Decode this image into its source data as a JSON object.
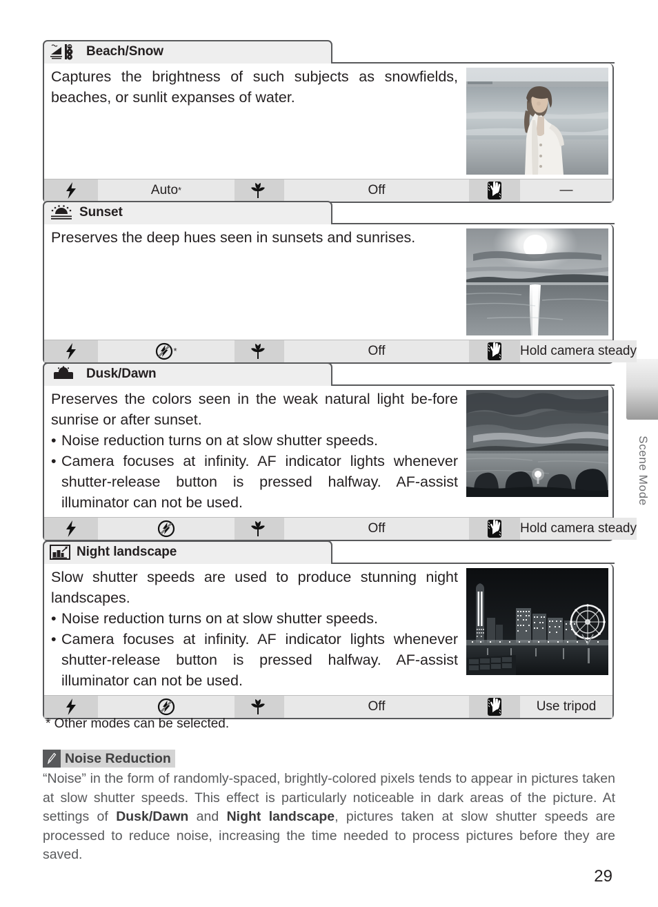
{
  "page": {
    "number": "29",
    "side_tab_label": "Scene Mode",
    "footnote": "* Other modes can be selected."
  },
  "scenes": [
    {
      "id": "beach-snow",
      "icon": "beach-snow-icon",
      "title": "Beach/Snow",
      "description": "Captures the brightness of such subjects as snowfields, beaches, or sunlit expanses of water.",
      "bullets": [],
      "photo": {
        "name": "beach-photo",
        "alt": "Woman in white vest standing on a bright beach"
      },
      "settings": {
        "flash_icon": "flash-icon",
        "flash_value": "Auto",
        "flash_star": true,
        "macro_icon": "macro-tulip-icon",
        "macro_value": "Off",
        "shake_icon": "camera-shake-icon",
        "shake_value": "—"
      }
    },
    {
      "id": "sunset",
      "icon": "sunset-icon",
      "title": "Sunset",
      "description": "Preserves the deep hues seen in sunsets and sunrises.",
      "bullets": [],
      "photo": {
        "name": "sunset-photo",
        "alt": "Sun setting over water with reflection"
      },
      "settings": {
        "flash_icon": "flash-icon",
        "flash_value": "",
        "flash_value_icon": "flash-off-icon",
        "flash_star": true,
        "macro_icon": "macro-tulip-icon",
        "macro_value": "Off",
        "shake_icon": "camera-shake-icon",
        "shake_value": "Hold camera steady"
      }
    },
    {
      "id": "dusk-dawn",
      "icon": "dusk-dawn-icon",
      "title": "Dusk/Dawn",
      "description": "Preserves the colors seen in the weak natural light be-fore sunrise or after sunset.",
      "bullets": [
        "Noise reduction turns on at slow shutter speeds.",
        "Camera focuses at infinity.  AF indicator lights whenever shutter-release button is pressed halfway.  AF-assist illuminator can not be used."
      ],
      "photo": {
        "name": "dusk-photo",
        "alt": "Dark clouds over a lake at dusk with trees in silhouette"
      },
      "settings": {
        "flash_icon": "flash-icon",
        "flash_value": "",
        "flash_value_icon": "flash-off-icon",
        "flash_star": false,
        "macro_icon": "macro-tulip-icon",
        "macro_value": "Off",
        "shake_icon": "camera-shake-icon",
        "shake_value": "Hold camera steady"
      }
    },
    {
      "id": "night-landscape",
      "icon": "night-landscape-icon",
      "title": "Night landscape",
      "description": "Slow shutter speeds are used to produce stunning night landscapes.",
      "bullets": [
        "Noise reduction turns on at slow shutter speeds.",
        "Camera focuses at infinity.  AF indicator lights whenever shutter-release button is pressed halfway.  AF-assist illuminator can not be used."
      ],
      "photo": {
        "name": "night-city-photo",
        "alt": "Night cityscape with illuminated towers and a Ferris wheel"
      },
      "settings": {
        "flash_icon": "flash-icon",
        "flash_value": "",
        "flash_value_icon": "flash-off-icon",
        "flash_star": false,
        "macro_icon": "macro-tulip-icon",
        "macro_value": "Off",
        "shake_icon": "camera-shake-icon",
        "shake_value": "Use tripod"
      }
    }
  ],
  "note": {
    "icon": "pencil-icon",
    "title": "Noise Reduction",
    "body_part1": "“Noise” in the form of randomly-spaced, brightly-colored pixels tends to appear in pictures taken at slow shutter speeds.  This effect is particularly noticeable in dark areas of the picture.  At settings of ",
    "bold1": "Dusk/Dawn",
    "body_part2": " and ",
    "bold2": "Night landscape",
    "body_part3": ", pictures taken at slow shutter speeds are processed to reduce noise, increasing the time needed to process pictures before they are saved."
  },
  "colors": {
    "border": "#58595b",
    "header_bg": "#eeeeee",
    "icon_cell": "#d2d2d2",
    "value_cell": "#e8e8e8",
    "note_text": "#58595b"
  }
}
